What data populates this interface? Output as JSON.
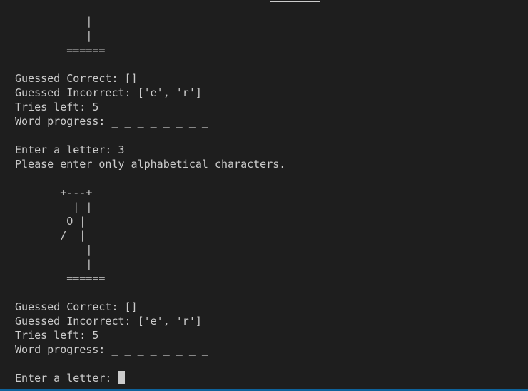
{
  "terminal": {
    "lines": [
      "           |",
      "           |",
      "        ======",
      "",
      "Guessed Correct: []",
      "Guessed Incorrect: ['e', 'r']",
      "Tries left: 5",
      "Word progress: _ _ _ _ _ _ _ _",
      "",
      "Enter a letter: 3",
      "Please enter only alphabetical characters.",
      "",
      "       +---+",
      "         | |",
      "        O |",
      "       /  |",
      "           |",
      "           |",
      "        ======",
      "",
      "Guessed Correct: []",
      "Guessed Incorrect: ['e', 'r']",
      "Tries left: 5",
      "Word progress: _ _ _ _ _ _ _ _",
      ""
    ],
    "prompt": "Enter a letter: "
  }
}
